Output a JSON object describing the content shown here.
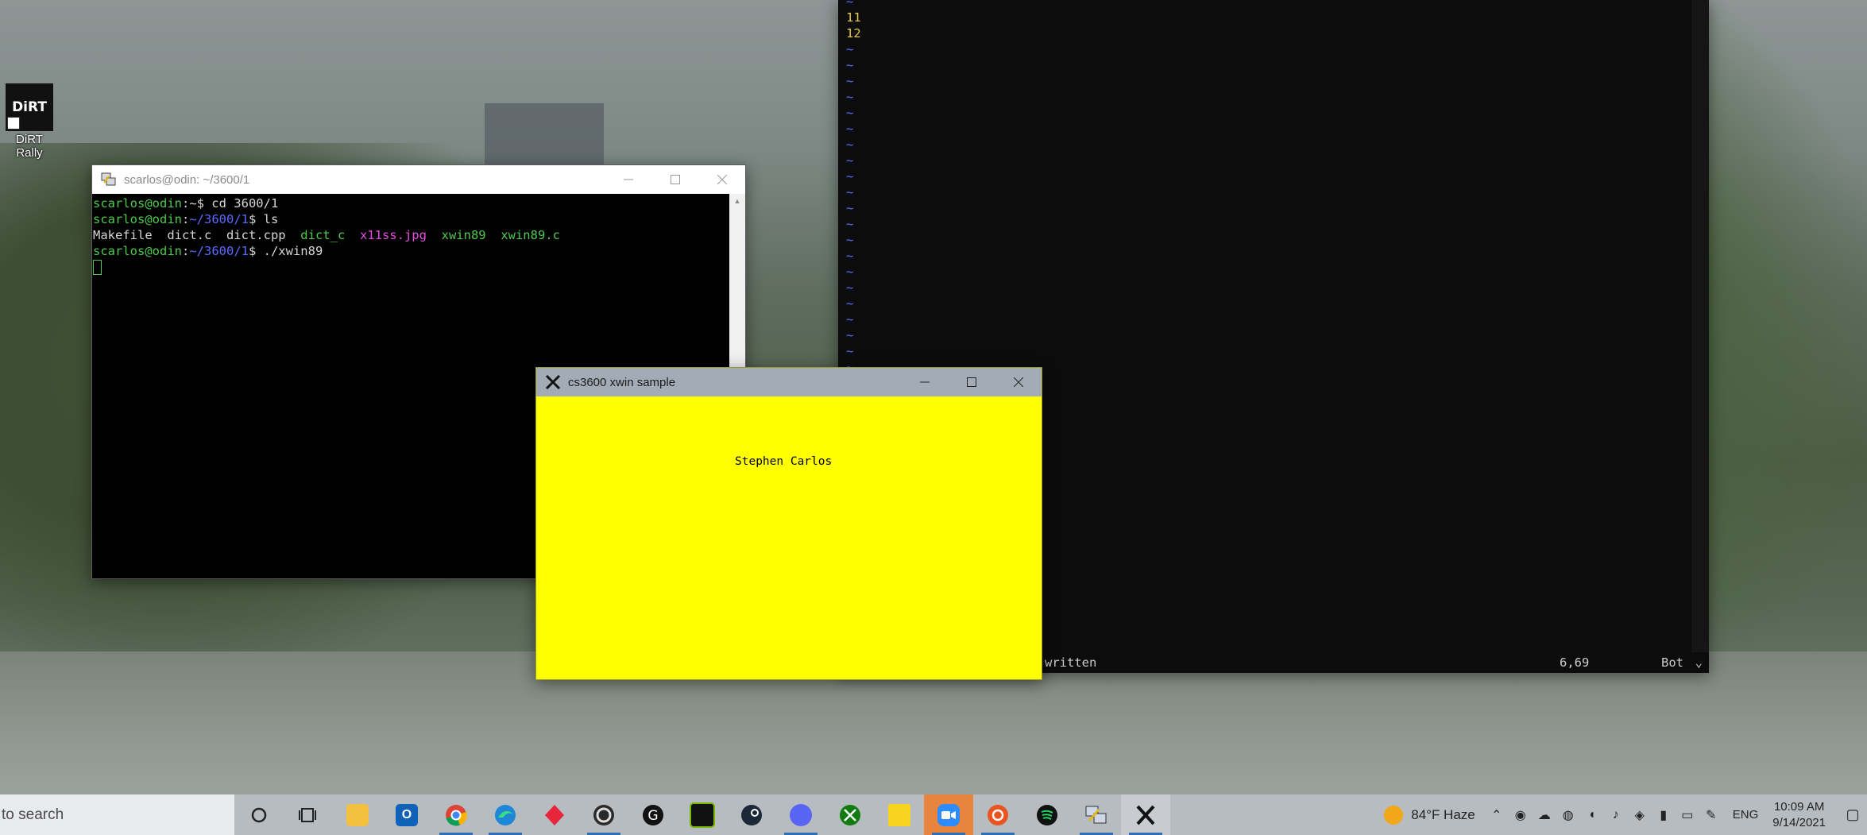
{
  "desktop": {
    "icon": {
      "name": "dirt-rally",
      "logo_text": "DiRT",
      "label": "DiRT Rally"
    }
  },
  "terminal": {
    "title": "scarlos@odin: ~/3600/1",
    "lines": [
      [
        {
          "t": "scarlos@odin",
          "c": "green"
        },
        {
          "t": ":~$ cd 3600/1",
          "c": "white"
        }
      ],
      [
        {
          "t": "scarlos@odin",
          "c": "green"
        },
        {
          "t": ":",
          "c": "white"
        },
        {
          "t": "~/3600/1",
          "c": "blue"
        },
        {
          "t": "$ ls",
          "c": "white"
        }
      ],
      [
        {
          "t": "Makefile  dict.c  dict.cpp  ",
          "c": "white"
        },
        {
          "t": "dict_c",
          "c": "green"
        },
        {
          "t": "  ",
          "c": "white"
        },
        {
          "t": "x11ss.jpg",
          "c": "magenta"
        },
        {
          "t": "  ",
          "c": "white"
        },
        {
          "t": "xwin89",
          "c": "green"
        },
        {
          "t": "  ",
          "c": "white"
        },
        {
          "t": "xwin89.c",
          "c": "green"
        }
      ],
      [
        {
          "t": "scarlos@odin",
          "c": "green"
        },
        {
          "t": ":",
          "c": "white"
        },
        {
          "t": "~/3600/1",
          "c": "blue"
        },
        {
          "t": "$ ./xwin89",
          "c": "white"
        }
      ]
    ]
  },
  "vim": {
    "line_numbers": [
      "11",
      "12"
    ],
    "tilde_count": 29,
    "status_message": "written",
    "cursor_position": "6,69",
    "scroll_position": "Bot"
  },
  "xwin": {
    "title": "cs3600 xwin sample",
    "content_text": "Stephen Carlos"
  },
  "taskbar": {
    "search_placeholder": "to search",
    "apps": [
      "cortana-icon",
      "task-view-icon",
      "file-explorer-icon",
      "outlook-icon",
      "chrome-icon",
      "edge-icon",
      "red-diamond-app-icon",
      "obs-icon",
      "logitech-g-icon",
      "nvidia-icon",
      "steam-icon",
      "discord-icon",
      "xbox-icon",
      "sticky-notes-icon",
      "zoom-icon",
      "ubuntu-icon",
      "spotify-icon",
      "putty-icon",
      "xming-icon"
    ],
    "weather": "84°F  Haze",
    "language": "ENG",
    "time": "10:09 AM",
    "date": "9/14/2021"
  },
  "colors": {
    "term_green": "#4ec94e",
    "term_blue": "#5b6bff",
    "term_magenta": "#e24ee2",
    "xwin_bg": "#ffff00",
    "vim_linenr": "#e6c54a"
  }
}
